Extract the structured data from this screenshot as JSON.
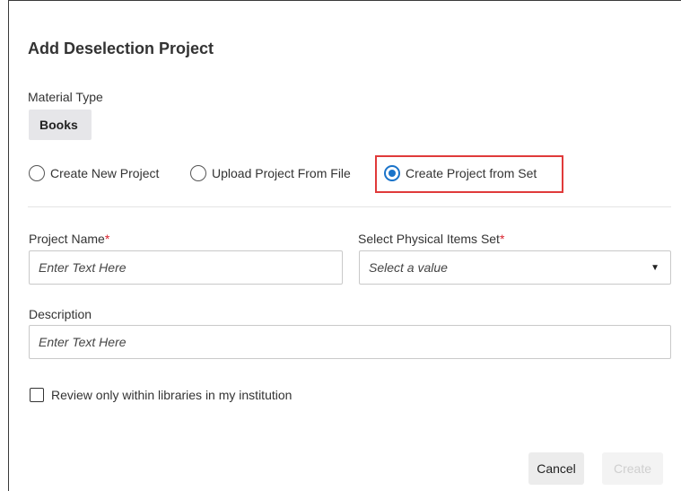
{
  "dialog": {
    "title": "Add Deselection Project",
    "material_type": {
      "label": "Material Type",
      "value": "Books"
    },
    "radio_options": [
      {
        "label": "Create New Project",
        "selected": false
      },
      {
        "label": "Upload Project From File",
        "selected": false
      },
      {
        "label": "Create Project from Set",
        "selected": true
      }
    ],
    "project_name": {
      "label": "Project Name",
      "required_mark": "*",
      "placeholder": "Enter Text Here"
    },
    "physical_items_set": {
      "label": "Select Physical Items Set",
      "required_mark": "*",
      "placeholder": "Select a value",
      "arrow": "▼"
    },
    "description": {
      "label": "Description",
      "placeholder": "Enter Text Here"
    },
    "checkbox": {
      "label": "Review only within libraries in my institution",
      "checked": false
    },
    "buttons": {
      "cancel": "Cancel",
      "create": "Create"
    }
  },
  "colors": {
    "accent": "#1a73c9",
    "highlight": "#e03a3a",
    "required": "#d9232e",
    "chip_bg": "#e6e6e9"
  }
}
